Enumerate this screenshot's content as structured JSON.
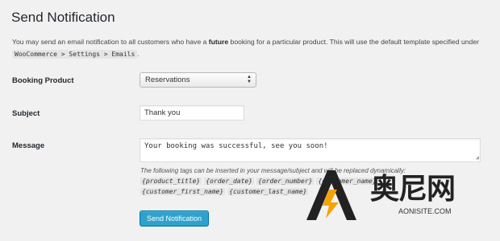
{
  "page": {
    "title": "Send Notification",
    "intro_pre": "You may send an email notification to all customers who have a ",
    "intro_strong": "future",
    "intro_mid": " booking for a particular product. This will use the default template specified under ",
    "intro_code": "WooCommerce > Settings > Emails",
    "intro_end": "."
  },
  "form": {
    "product_label": "Booking Product",
    "product_selected": "Reservations",
    "subject_label": "Subject",
    "subject_value": "Thank you",
    "message_label": "Message",
    "message_value": "Your booking was successful, see you soon!",
    "hint": "The following tags can be inserted in your message/subject and will be replaced dynamically:",
    "tags": [
      "{product_title}",
      "{order_date}",
      "{order_number}",
      "{customer_name}",
      "{customer_first_name}",
      "{customer_last_name}"
    ],
    "submit_label": "Send Notification"
  },
  "watermark": {
    "text": "奥尼网",
    "sub": "AONISITE.COM"
  },
  "colors": {
    "accent": "#2ea2cc",
    "background": "#f1f1f1"
  }
}
